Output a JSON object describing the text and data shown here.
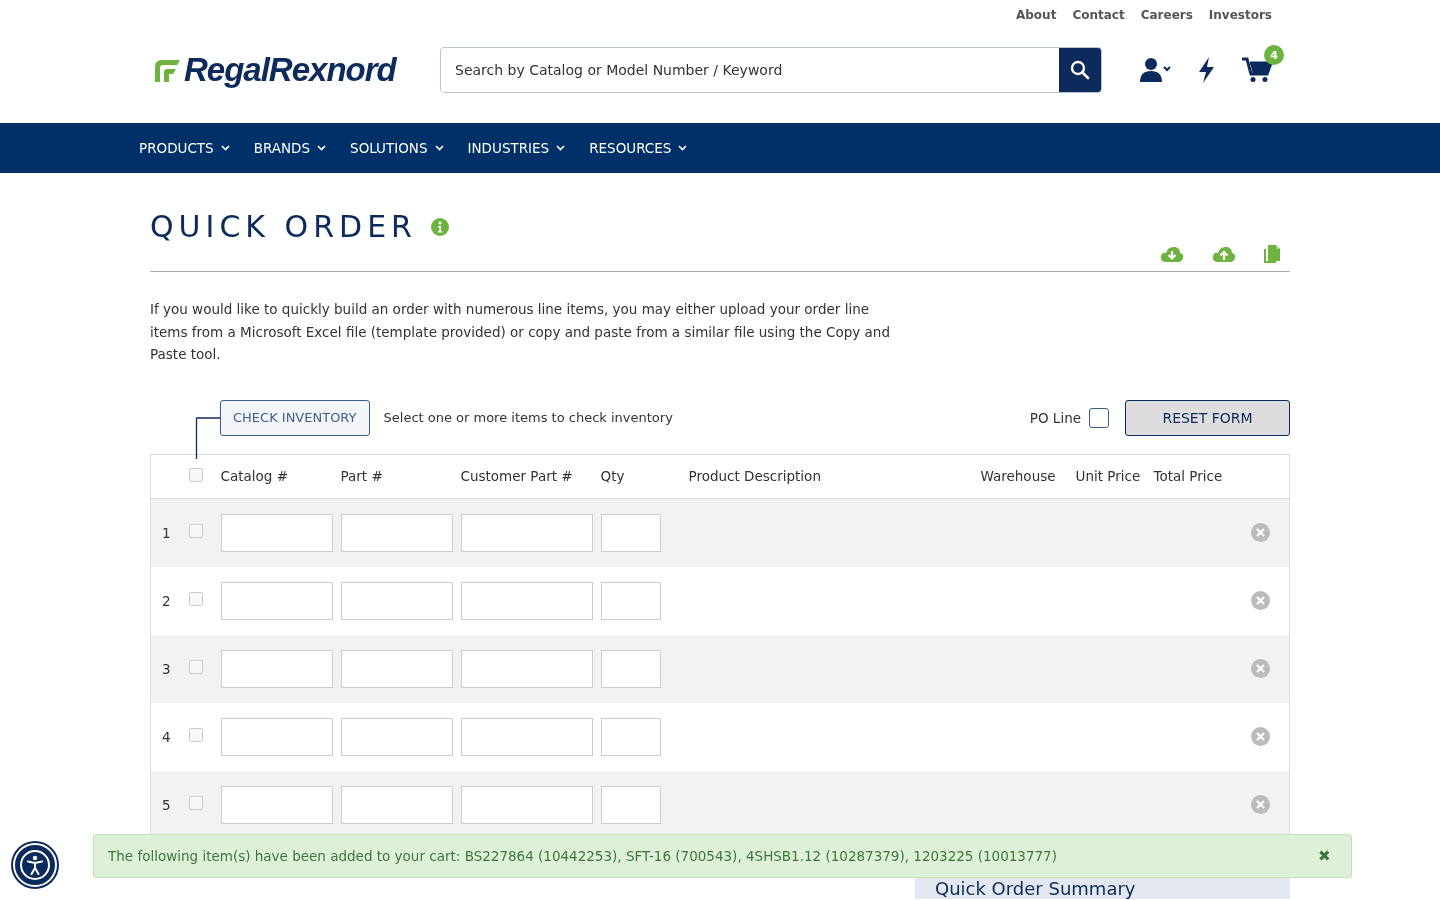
{
  "top_links": [
    "About",
    "Contact",
    "Careers",
    "Investors"
  ],
  "logo": {
    "text": "RegalRexnord"
  },
  "search": {
    "placeholder": "Search by Catalog or Model Number / Keyword"
  },
  "cart": {
    "count": "4"
  },
  "nav": [
    "PRODUCTS",
    "BRANDS",
    "SOLUTIONS",
    "INDUSTRIES",
    "RESOURCES"
  ],
  "page": {
    "title": "QUICK ORDER",
    "description": "If you would like to quickly build an order with numerous line items, you may either upload your order line items from a Microsoft Excel file (template provided) or copy and paste from a similar file using the Copy and Paste tool."
  },
  "toolbar": {
    "check_inventory": "CHECK INVENTORY",
    "hint": "Select one or more items to check inventory",
    "po_line": {
      "label": "PO Line",
      "checked": false
    },
    "reset": "RESET FORM"
  },
  "table": {
    "select_all": {
      "checked": false
    },
    "columns": [
      "Catalog #",
      "Part #",
      "Customer Part #",
      "Qty",
      "Product Description",
      "Warehouse",
      "Unit Price",
      "Total Price"
    ],
    "rows": [
      {
        "number": "1",
        "selected": false
      },
      {
        "number": "2",
        "selected": false
      },
      {
        "number": "3",
        "selected": false
      },
      {
        "number": "4",
        "selected": false
      },
      {
        "number": "5",
        "selected": false
      }
    ]
  },
  "toast": {
    "text": "The following item(s) have been added to your cart: BS227864 (10442253), SFT-16 (700543), 4SHSB1.12 (10287379), 1203225 (10013777)",
    "close": "✖"
  },
  "summary": {
    "title": "Quick Order Summary"
  }
}
